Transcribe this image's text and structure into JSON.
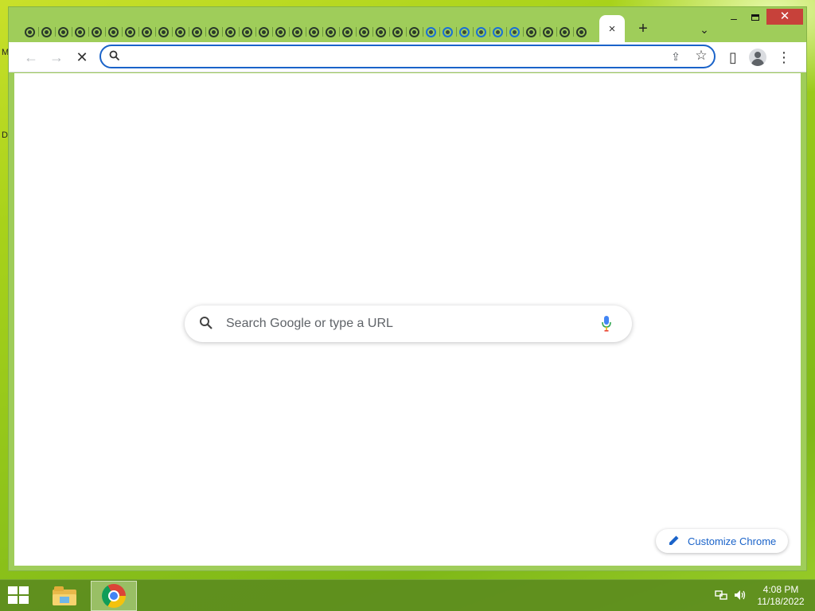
{
  "desktop": {
    "edge_letters": [
      "M",
      "D"
    ]
  },
  "browser": {
    "tabs": {
      "dark_count": 24,
      "blue_count": 6,
      "light_count": 4
    },
    "active_tab": {
      "close_glyph": "×"
    },
    "new_tab_glyph": "+",
    "tab_search_glyph": "⌄",
    "window_controls": {
      "minimize": "–",
      "close": "✕"
    },
    "toolbar": {
      "back_glyph": "←",
      "forward_glyph": "→",
      "stop_glyph": "✕",
      "omnibox_value": "",
      "share_glyph": "⇪",
      "bookmark_glyph": "☆",
      "side_panel_glyph": "▯",
      "menu_glyph": "⋮"
    },
    "ntp": {
      "search_placeholder": "Search Google or type a URL",
      "customize_label": "Customize Chrome"
    }
  },
  "taskbar": {
    "apps": [
      "file-explorer",
      "chrome"
    ],
    "active_app": "chrome",
    "clock_time": "4:08 PM",
    "clock_date": "11/18/2022"
  },
  "colors": {
    "accent": "#1a63c9",
    "close_red": "#c7413a",
    "taskbar": "#5c8c1e"
  }
}
